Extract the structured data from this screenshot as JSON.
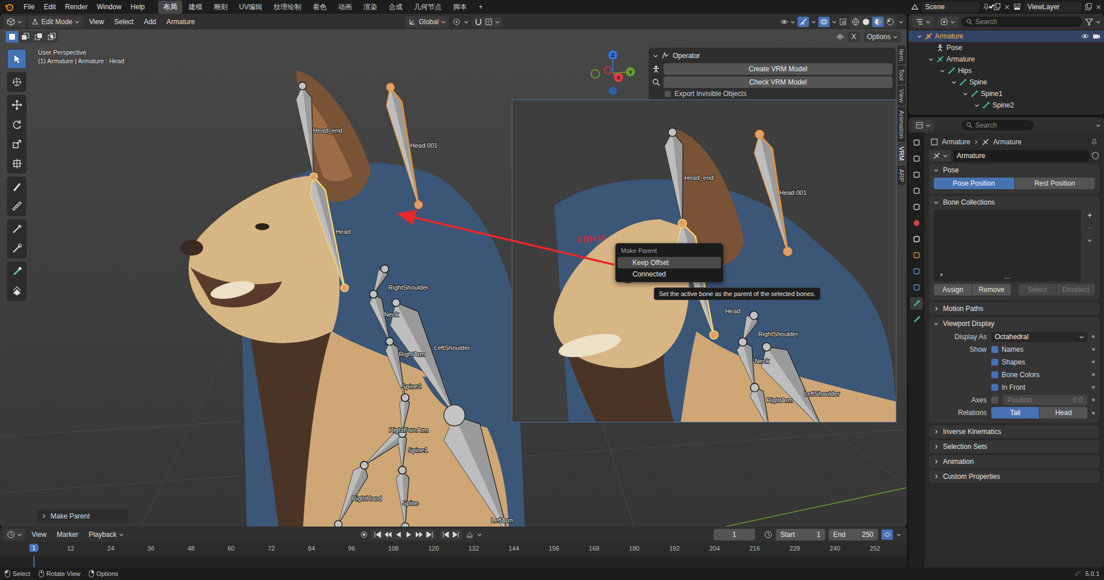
{
  "menubar": {
    "menus": [
      "File",
      "Edit",
      "Render",
      "Window",
      "Help"
    ],
    "workspaces": [
      {
        "label": "布局",
        "selected": true
      },
      {
        "label": "建模",
        "selected": false
      },
      {
        "label": "雕刻",
        "selected": false
      },
      {
        "label": "UV编辑",
        "selected": false
      },
      {
        "label": "纹理绘制",
        "selected": false
      },
      {
        "label": "着色",
        "selected": false
      },
      {
        "label": "动画",
        "selected": false
      },
      {
        "label": "渲染",
        "selected": false
      },
      {
        "label": "合成",
        "selected": false
      },
      {
        "label": "几何节点",
        "selected": false
      },
      {
        "label": "脚本",
        "selected": false
      }
    ],
    "add_workspace": "+",
    "scene": "Scene",
    "view_layer": "ViewLayer"
  },
  "viewport": {
    "mode": "Edit Mode",
    "menus": [
      "View",
      "Select",
      "Add",
      "Armature"
    ],
    "orientation": "Global",
    "mirror_label": "X",
    "options": "Options",
    "info": [
      "User Perspective",
      "(1) Armature | Armature : Head"
    ],
    "gizmo": [
      {
        "label": "Z",
        "color": "#2f73d9"
      },
      {
        "label": "Y",
        "color": "#6a9e2a"
      },
      {
        "label": "X",
        "color": "#e03c4a"
      }
    ],
    "bones": [
      {
        "label": "Head_end",
        "selected": false,
        "active": false
      },
      {
        "label": "Head.001",
        "selected": true,
        "active": false
      },
      {
        "label": "Head",
        "selected": true,
        "active": true
      },
      {
        "label": "RightShoulder",
        "selected": false,
        "active": false
      },
      {
        "label": "Neck",
        "selected": false,
        "active": false
      },
      {
        "label": "LeftShoulder",
        "selected": false,
        "active": false
      },
      {
        "label": "RightArm",
        "selected": false,
        "active": false
      },
      {
        "label": "Spine2",
        "selected": false,
        "active": false
      },
      {
        "label": "RightForeArm",
        "selected": false,
        "active": false
      },
      {
        "label": "Spine1",
        "selected": false,
        "active": false
      },
      {
        "label": "RightHand",
        "selected": false,
        "active": false
      },
      {
        "label": "Spine",
        "selected": false,
        "active": false
      },
      {
        "label": "LeftArm",
        "selected": false,
        "active": false
      }
    ],
    "side_tabs": [
      {
        "label": "Item",
        "selected": false
      },
      {
        "label": "Tool",
        "selected": false
      },
      {
        "label": "View",
        "selected": false
      },
      {
        "label": "Animation",
        "selected": false
      },
      {
        "label": "VRM",
        "selected": true
      },
      {
        "label": "ARP",
        "selected": false
      }
    ],
    "operator_panel": {
      "title": "Operator",
      "buttons": [
        "Create VRM Model",
        "Check VRM Model"
      ],
      "option": "Export Invisible Objects"
    },
    "last_operator": "Make Parent"
  },
  "annotation": {
    "text": "ctrl+P"
  },
  "inset": {
    "bones": [
      {
        "label": "Head_end",
        "selected": false,
        "active": false
      },
      {
        "label": "Head.001",
        "selected": true,
        "active": false
      },
      {
        "label": "Head",
        "selected": true,
        "active": true
      },
      {
        "label": "RightShoulder",
        "selected": false,
        "active": false
      },
      {
        "label": "Neck",
        "selected": false,
        "active": false
      },
      {
        "label": "LeftShoulder",
        "selected": false,
        "active": false
      },
      {
        "label": "RightArm",
        "selected": false,
        "active": false
      }
    ],
    "menu": {
      "title": "Make Parent",
      "items": [
        {
          "label": "Keep Offset",
          "selected": true
        },
        {
          "label": "Connected",
          "selected": false
        }
      ]
    },
    "tooltip": "Set the active bone as the parent of the selected bones."
  },
  "timeline": {
    "menus": [
      "View",
      "Marker",
      "Playback"
    ],
    "current_frame": "1",
    "start_label": "Start",
    "start": "1",
    "end_label": "End",
    "end": "250",
    "playhead": "1",
    "ruler": [
      "12",
      "24",
      "36",
      "48",
      "60",
      "72",
      "84",
      "96",
      "108",
      "120",
      "132",
      "144",
      "156",
      "168",
      "180",
      "192",
      "204",
      "216",
      "228",
      "240",
      "252"
    ]
  },
  "status_bar": {
    "hints": [
      "Select",
      "Rotate View",
      "Options"
    ],
    "version": "5.0.1"
  },
  "outliner": {
    "search": "Search",
    "rows": [
      {
        "label": "Armature",
        "depth": 0,
        "has_children": true,
        "expanded": true,
        "selected": true
      },
      {
        "label": "Pose",
        "depth": 1,
        "has_children": false,
        "expanded": false,
        "selected": false
      },
      {
        "label": "Armature",
        "depth": 1,
        "has_children": true,
        "expanded": true,
        "selected": false
      },
      {
        "label": "Hips",
        "depth": 2,
        "has_children": true,
        "expanded": true,
        "selected": false
      },
      {
        "label": "Spine",
        "depth": 3,
        "has_children": true,
        "expanded": true,
        "selected": false
      },
      {
        "label": "Spine1",
        "depth": 4,
        "has_children": true,
        "expanded": true,
        "selected": false
      },
      {
        "label": "Spine2",
        "depth": 5,
        "has_children": true,
        "expanded": true,
        "selected": false
      }
    ]
  },
  "properties": {
    "search": "Search",
    "breadcrumb": [
      "Armature",
      "Armature"
    ],
    "name": "Armature",
    "pose": {
      "title": "Pose",
      "expanded": true,
      "options": [
        {
          "label": "Pose Position",
          "selected": true
        },
        {
          "label": "Rest Position",
          "selected": false
        }
      ]
    },
    "bone_collections": {
      "title": "Bone Collections",
      "expanded": true,
      "add": "+",
      "buttons": [
        {
          "label": "Assign",
          "disabled": false
        },
        {
          "label": "Remove",
          "disabled": false
        },
        {
          "label": "Select",
          "disabled": true
        },
        {
          "label": "Deselect",
          "disabled": true
        }
      ]
    },
    "motion_paths": {
      "title": "Motion Paths",
      "expanded": false
    },
    "viewport_display": {
      "title": "Viewport Display",
      "expanded": true,
      "display_as_label": "Display As",
      "display_as": "Octahedral",
      "show_label": "Show",
      "show": [
        {
          "label": "Names",
          "checked": true
        },
        {
          "label": "Shapes",
          "checked": true
        },
        {
          "label": "Bone Colors",
          "checked": true
        },
        {
          "label": "In Front",
          "checked": true
        }
      ],
      "axes": {
        "label": "Axes",
        "checked": false,
        "position_label": "Position",
        "position": "0.0",
        "disabled": true
      },
      "relations": {
        "label": "Relations",
        "options": [
          {
            "label": "Tail",
            "selected": true
          },
          {
            "label": "Head",
            "selected": false
          }
        ]
      }
    },
    "collapsed": [
      {
        "title": "Inverse Kinematics",
        "expanded": false
      },
      {
        "title": "Selection Sets",
        "expanded": false
      },
      {
        "title": "Animation",
        "expanded": false
      },
      {
        "title": "Custom Properties",
        "expanded": false
      }
    ]
  }
}
